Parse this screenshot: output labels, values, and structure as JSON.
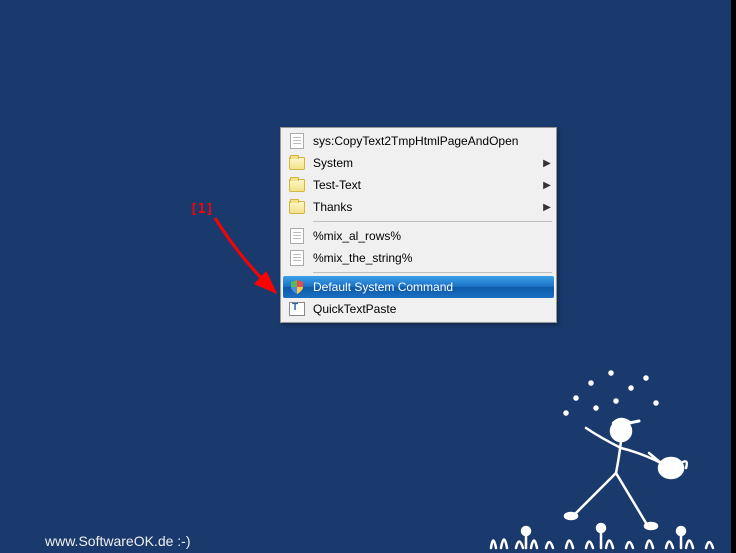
{
  "annotation": {
    "label": "[1]"
  },
  "menu": {
    "items": [
      {
        "label": "sys:CopyText2TmpHtmlPageAndOpen",
        "icon": "text-file-icon",
        "submenu": false
      },
      {
        "label": "System",
        "icon": "folder-icon",
        "submenu": true
      },
      {
        "label": "Test-Text",
        "icon": "folder-icon",
        "submenu": true
      },
      {
        "label": "Thanks",
        "icon": "folder-icon",
        "submenu": true
      }
    ],
    "items2": [
      {
        "label": "%mix_al_rows%",
        "icon": "text-file-icon"
      },
      {
        "label": "%mix_the_string%",
        "icon": "text-file-icon"
      }
    ],
    "items3": [
      {
        "label": "Default System Command",
        "icon": "shield-icon",
        "highlighted": true
      },
      {
        "label": "QuickTextPaste",
        "icon": "app-icon"
      }
    ]
  },
  "watermark": "www.SoftwareOK.de  :-)"
}
